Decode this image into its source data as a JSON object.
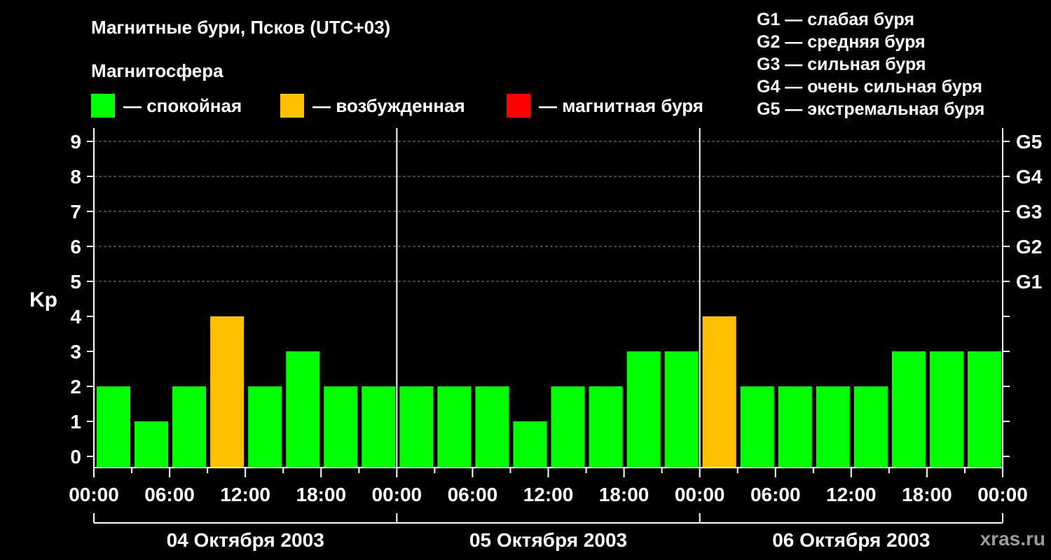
{
  "title": "Магнитные бури, Псков (UTC+03)",
  "magnetosphere_label": "Магнитосфера",
  "legend": [
    {
      "color": "#00ff00",
      "label": "— спокойная"
    },
    {
      "color": "#ffc000",
      "label": "— возбужденная"
    },
    {
      "color": "#ff0000",
      "label": "— магнитная буря"
    }
  ],
  "storm_levels": [
    "G1 — слабая буря",
    "G2 — средняя буря",
    "G3 — сильная буря",
    "G4 — очень сильная буря",
    "G5 — экстремальная буря"
  ],
  "source": "xras.ru",
  "chart_data": {
    "type": "bar",
    "ylabel": "Kp",
    "ylim": [
      0,
      9
    ],
    "yticks": [
      0,
      1,
      2,
      3,
      4,
      5,
      6,
      7,
      8,
      9
    ],
    "right_axis_labels": [
      {
        "kp": 5,
        "label": "G1"
      },
      {
        "kp": 6,
        "label": "G2"
      },
      {
        "kp": 7,
        "label": "G3"
      },
      {
        "kp": 8,
        "label": "G4"
      },
      {
        "kp": 9,
        "label": "G5"
      }
    ],
    "x_tick_labels": [
      "00:00",
      "06:00",
      "12:00",
      "18:00",
      "00:00",
      "06:00",
      "12:00",
      "18:00",
      "00:00",
      "06:00",
      "12:00",
      "18:00",
      "00:00"
    ],
    "days": [
      "04 Октября 2003",
      "05 Октября 2003",
      "06 Октября 2003"
    ],
    "bar_interval_hours": 3,
    "color_thresholds": {
      "quiet_below": 4,
      "storm_from": 5
    },
    "grid": true,
    "series": [
      {
        "day": "04 Октября 2003",
        "values": [
          2,
          1,
          2,
          4,
          2,
          3,
          2,
          2
        ]
      },
      {
        "day": "05 Октября 2003",
        "values": [
          2,
          2,
          2,
          1,
          2,
          2,
          3,
          3
        ]
      },
      {
        "day": "06 Октября 2003",
        "values": [
          4,
          2,
          2,
          2,
          2,
          3,
          3,
          3
        ]
      }
    ]
  }
}
